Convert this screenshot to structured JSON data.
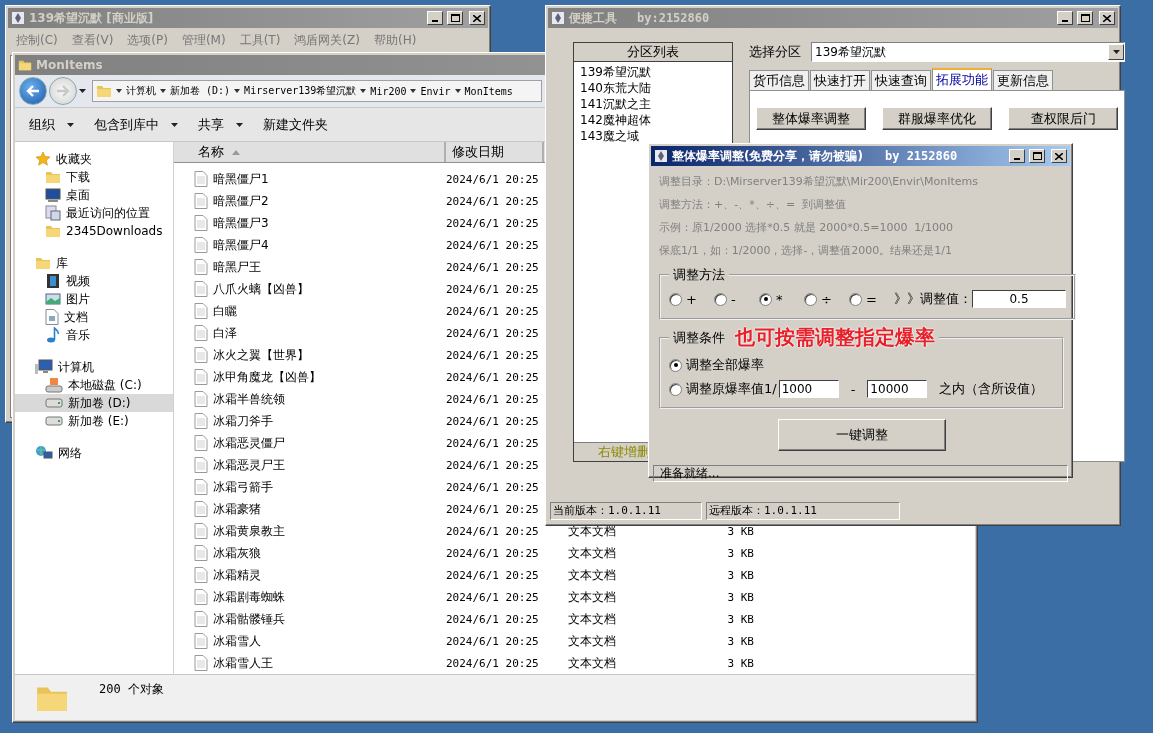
{
  "main_window": {
    "title": "139希望沉默 [商业版]",
    "menu": [
      "控制(C)",
      "查看(V)",
      "选项(P)",
      "管理(M)",
      "工具(T)",
      "鸿盾网关(Z)",
      "帮助(H)"
    ]
  },
  "explorer": {
    "title": "MonItems",
    "breadcrumbs": [
      "计算机",
      "新加卷 (D:)",
      "Mirserver139希望沉默",
      "Mir200",
      "Envir",
      "MonItems"
    ],
    "toolbar": [
      {
        "label": "组织",
        "dropdown": true
      },
      {
        "label": "包含到库中",
        "dropdown": true
      },
      {
        "label": "共享",
        "dropdown": true
      },
      {
        "label": "新建文件夹",
        "dropdown": false
      }
    ],
    "sidebar": [
      {
        "label": "收藏夹",
        "selected": false,
        "children": [
          {
            "label": "下载",
            "selected": false
          },
          {
            "label": "桌面",
            "selected": false
          },
          {
            "label": "最近访问的位置",
            "selected": false
          },
          {
            "label": "2345Downloads",
            "selected": false
          }
        ]
      },
      {
        "label": "库",
        "selected": false,
        "children": [
          {
            "label": "视频",
            "selected": false
          },
          {
            "label": "图片",
            "selected": false
          },
          {
            "label": "文档",
            "selected": false
          },
          {
            "label": "音乐",
            "selected": false
          }
        ]
      },
      {
        "label": "计算机",
        "selected": false,
        "children": [
          {
            "label": "本地磁盘 (C:)",
            "selected": false
          },
          {
            "label": "新加卷 (D:)",
            "selected": true
          },
          {
            "label": "新加卷 (E:)",
            "selected": false
          }
        ]
      },
      {
        "label": "网络",
        "selected": false
      }
    ],
    "columns": [
      "名称",
      "修改日期"
    ],
    "rows": [
      {
        "name": "暗黑僵尸1",
        "modified": "2024/6/1 20:25"
      },
      {
        "name": "暗黑僵尸2",
        "modified": "2024/6/1 20:25"
      },
      {
        "name": "暗黑僵尸3",
        "modified": "2024/6/1 20:25"
      },
      {
        "name": "暗黑僵尸4",
        "modified": "2024/6/1 20:25"
      },
      {
        "name": "暗黑尸王",
        "modified": "2024/6/1 20:25"
      },
      {
        "name": "八爪火螭【凶兽】",
        "modified": "2024/6/1 20:25"
      },
      {
        "name": "白矖",
        "modified": "2024/6/1 20:25"
      },
      {
        "name": "白泽",
        "modified": "2024/6/1 20:25"
      },
      {
        "name": "冰火之翼【世界】",
        "modified": "2024/6/1 20:25"
      },
      {
        "name": "冰甲角魔龙【凶兽】",
        "modified": "2024/6/1 20:25"
      },
      {
        "name": "冰霜半兽统领",
        "modified": "2024/6/1 20:25"
      },
      {
        "name": "冰霜刀斧手",
        "modified": "2024/6/1 20:25"
      },
      {
        "name": "冰霜恶灵僵尸",
        "modified": "2024/6/1 20:25"
      },
      {
        "name": "冰霜恶灵尸王",
        "modified": "2024/6/1 20:25"
      },
      {
        "name": "冰霜弓箭手",
        "modified": "2024/6/1 20:25"
      },
      {
        "name": "冰霜豪猪",
        "modified": "2024/6/1 20:25"
      },
      {
        "name": "冰霜黄泉教主",
        "modified": "2024/6/1 20:25",
        "type": "文本文档",
        "size": "3 KB"
      },
      {
        "name": "冰霜灰狼",
        "modified": "2024/6/1 20:25",
        "type": "文本文档",
        "size": "3 KB"
      },
      {
        "name": "冰霜精灵",
        "modified": "2024/6/1 20:25",
        "type": "文本文档",
        "size": "3 KB"
      },
      {
        "name": "冰霜剧毒蜘蛛",
        "modified": "2024/6/1 20:25",
        "type": "文本文档",
        "size": "3 KB"
      },
      {
        "name": "冰霜骷髅锤兵",
        "modified": "2024/6/1 20:25",
        "type": "文本文档",
        "size": "3 KB"
      },
      {
        "name": "冰霜雪人",
        "modified": "2024/6/1 20:25",
        "type": "文本文档",
        "size": "3 KB"
      },
      {
        "name": "冰霜雪人王",
        "modified": "2024/6/1 20:25",
        "type": "文本文档",
        "size": "3 KB"
      }
    ],
    "status": "200 个对象"
  },
  "tool_window": {
    "title": "便捷工具",
    "author": "by:2152860",
    "partition_list": {
      "header": "分区列表",
      "items": [
        "139希望沉默",
        "140东荒大陆",
        "141沉默之主",
        "142魔神超体",
        "143魔之域"
      ],
      "footer": "右键增删"
    },
    "select_label": "选择分区",
    "select_value": "139希望沉默",
    "tabs": [
      {
        "label": "货币信息",
        "selected": false
      },
      {
        "label": "快速打开",
        "selected": false
      },
      {
        "label": "快速查询",
        "selected": false
      },
      {
        "label": "拓展功能",
        "selected": true
      },
      {
        "label": "更新信息",
        "selected": false
      }
    ],
    "actions": [
      "整体爆率调整",
      "群服爆率优化",
      "查权限后门"
    ],
    "status": [
      "当前版本：1.0.1.11",
      "远程版本：1.0.1.11"
    ]
  },
  "dialog": {
    "title": "整体爆率调整(免费分享，请勿被骗)",
    "author": "by 2152860",
    "info_lines": [
      "调整目录：D:\\Mirserver139希望沉默\\Mir200\\Envir\\MonItems",
      "调整方法：+、-、*、÷、=  到调整值",
      "示例：原1/2000 选择*0.5 就是 2000*0.5=1000  1/1000",
      "保底1/1，如：1/2000，选择-，调整值2000。结果还是1/1"
    ],
    "method_group": {
      "legend": "调整方法",
      "options": [
        {
          "label": "+",
          "selected": false
        },
        {
          "label": "-",
          "selected": false
        },
        {
          "label": "*",
          "selected": true
        },
        {
          "label": "÷",
          "selected": false
        },
        {
          "label": "=",
          "selected": false
        }
      ],
      "value_label": "》》调整值：",
      "value": "0.5"
    },
    "condition_group": {
      "legend": "调整条件",
      "annotation": "也可按需调整指定爆率",
      "options": [
        {
          "kind": "plain",
          "label": "调整全部爆率",
          "selected": true
        },
        {
          "kind": "range",
          "label": "调整原爆率值1/",
          "from": "1000",
          "dash": "-",
          "to": "10000",
          "suffix": "之内（含所设值）",
          "selected": false
        }
      ]
    },
    "button": "一键调整",
    "status": "准备就绪..."
  }
}
